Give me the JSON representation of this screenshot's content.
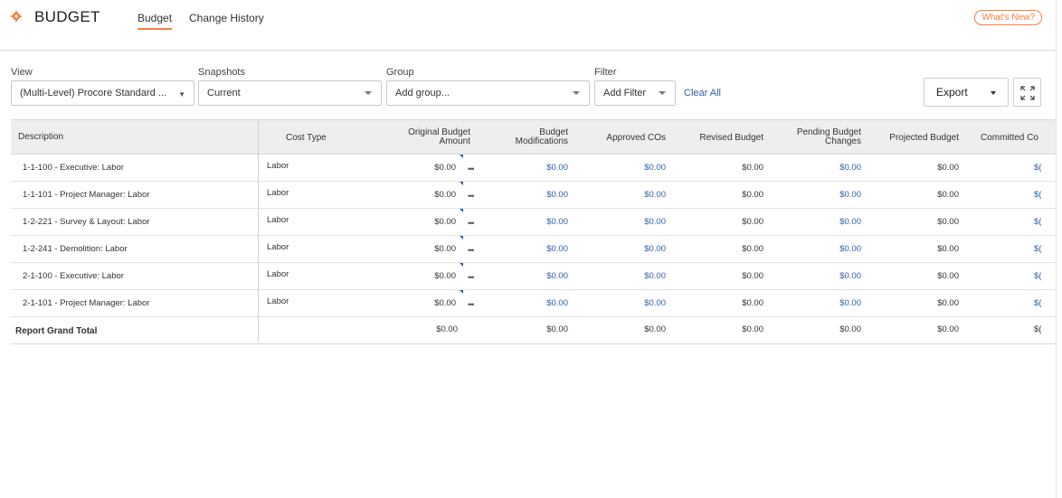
{
  "header": {
    "title": "BUDGET",
    "tabs": [
      {
        "label": "Budget"
      },
      {
        "label": "Change History"
      }
    ],
    "whats_new": "What's New?"
  },
  "colors": {
    "accent": "#f47e42",
    "link": "#2c5fa8"
  },
  "filters": {
    "view": {
      "label": "View",
      "value": "(Multi-Level) Procore Standard ..."
    },
    "snapshots": {
      "label": "Snapshots",
      "value": "Current"
    },
    "group": {
      "label": "Group",
      "placeholder": "Add group..."
    },
    "filter": {
      "label": "Filter",
      "value": "Add Filter"
    },
    "clear_all": "Clear All"
  },
  "toolbar": {
    "export": "Export"
  },
  "table": {
    "columns": {
      "description": "Description",
      "cost_type": "Cost Type",
      "original_budget_l1": "Original Budget",
      "original_budget_l2": "Amount",
      "budget_mod_l1": "Budget",
      "budget_mod_l2": "Modifications",
      "approved_cos": "Approved COs",
      "revised_budget": "Revised Budget",
      "pending_l1": "Pending Budget",
      "pending_l2": "Changes",
      "projected_budget": "Projected Budget",
      "committed": "Committed Co"
    },
    "rows": [
      {
        "description": "1-1-100 - Executive: Labor",
        "cost_type": "Labor",
        "original": "$0.00",
        "mods": "$0.00",
        "approved": "$0.00",
        "revised": "$0.00",
        "pending": "$0.00",
        "projected": "$0.00",
        "committed": "$("
      },
      {
        "description": "1-1-101 - Project Manager: Labor",
        "cost_type": "Labor",
        "original": "$0.00",
        "mods": "$0.00",
        "approved": "$0.00",
        "revised": "$0.00",
        "pending": "$0.00",
        "projected": "$0.00",
        "committed": "$("
      },
      {
        "description": "1-2-221 - Survey & Layout: Labor",
        "cost_type": "Labor",
        "original": "$0.00",
        "mods": "$0.00",
        "approved": "$0.00",
        "revised": "$0.00",
        "pending": "$0.00",
        "projected": "$0.00",
        "committed": "$("
      },
      {
        "description": "1-2-241 - Demolition: Labor",
        "cost_type": "Labor",
        "original": "$0.00",
        "mods": "$0.00",
        "approved": "$0.00",
        "revised": "$0.00",
        "pending": "$0.00",
        "projected": "$0.00",
        "committed": "$("
      },
      {
        "description": "2-1-100 - Executive: Labor",
        "cost_type": "Labor",
        "original": "$0.00",
        "mods": "$0.00",
        "approved": "$0.00",
        "revised": "$0.00",
        "pending": "$0.00",
        "projected": "$0.00",
        "committed": "$("
      },
      {
        "description": "2-1-101 - Project Manager: Labor",
        "cost_type": "Labor",
        "original": "$0.00",
        "mods": "$0.00",
        "approved": "$0.00",
        "revised": "$0.00",
        "pending": "$0.00",
        "projected": "$0.00",
        "committed": "$("
      }
    ],
    "total": {
      "label": "Report Grand Total",
      "original": "$0.00",
      "mods": "$0.00",
      "approved": "$0.00",
      "revised": "$0.00",
      "pending": "$0.00",
      "projected": "$0.00",
      "committed": "$("
    }
  }
}
